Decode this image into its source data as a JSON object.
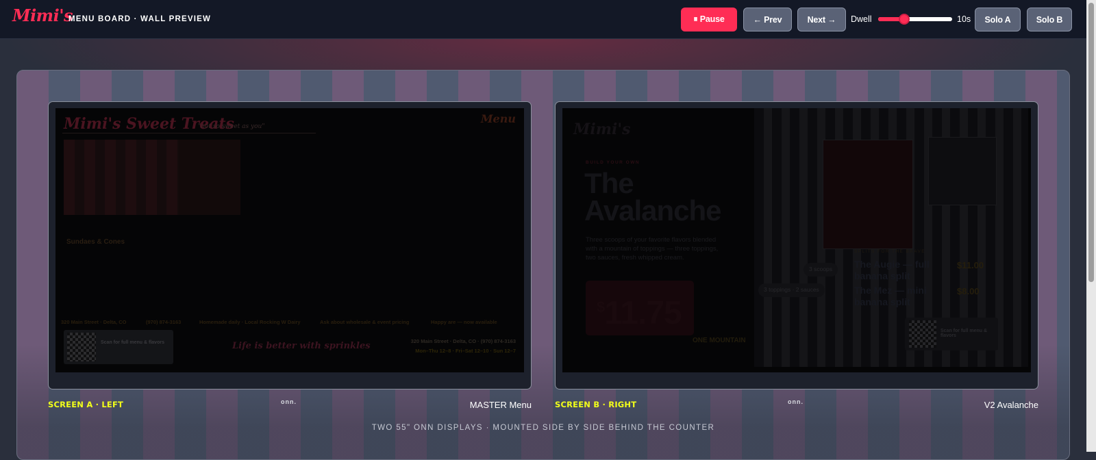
{
  "topbar": {
    "brand": "Mimi's",
    "subtitle": "MENU BOARD · WALL PREVIEW",
    "pause_label": "⏸ Pause",
    "prev_label": "← Prev",
    "next_label": "Next →",
    "dwell_label": "Dwell",
    "dwell_value": "10s",
    "dwell_level": 0.33,
    "solo_a_label": "Solo A",
    "solo_b_label": "Solo B"
  },
  "colors": {
    "accent": "#ff2d55",
    "caption_yellow": "#f2ff1a",
    "topbar_bg": "#131826"
  },
  "screen_a": {
    "caption": "SCREEN A · LEFT",
    "brand_mark": "onn.",
    "mode": "MASTER Menu",
    "content": {
      "title": "Mimi's Sweet Treats",
      "tagline": "\"not so sweet as you\"",
      "corner": "Menu",
      "section": "Sundaes & Cones",
      "info": [
        "320 Main Street · Delta, CO",
        "(970) 874-3163",
        "Homemade daily · Local Rocking W Dairy",
        "Ask about wholesale & event pricing",
        "Happy are — now available"
      ],
      "qr_text": "Scan for full menu & flavors",
      "slogan": "Life is better with sprinkles",
      "address": "320 Main Street · Delta, CO · (970) 874-3163",
      "hours": "Mon–Thu 12–8 · Fri–Sat 12–10 · Sun 12–7"
    }
  },
  "screen_b": {
    "caption": "SCREEN B · RIGHT",
    "brand_mark": "onn.",
    "mode": "V2 Avalanche",
    "content": {
      "logo": "Mimi's",
      "eyebrow": "BUILD YOUR OWN",
      "title": "The Avalanche",
      "description": "Three scoops of your favorite flavors blended with a mountain of toppings — three toppings, two sauces, fresh whipped cream.",
      "price_currency": "$",
      "price": "11.75",
      "pill_1": "3 scoops",
      "pill_2": "3 toppings · 2 sauces",
      "sub_label": "ONE MOUNTAIN",
      "list_head": "SPLITS FOR THE BRAVE",
      "items": [
        {
          "name": "The Augie — full banana split",
          "price": "$11.00"
        },
        {
          "name": "The Mez — mini banana split",
          "price": "$8.00"
        }
      ],
      "qr_text": "Scan for full menu & flavors"
    }
  },
  "footer_note": "TWO 55\" ONN DISPLAYS · MOUNTED SIDE BY SIDE BEHIND THE COUNTER"
}
